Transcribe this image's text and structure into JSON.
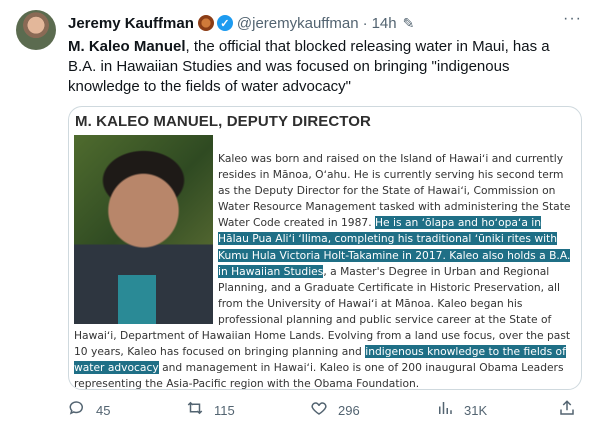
{
  "tweet": {
    "author_name": "Jeremy Kauffman",
    "handle": "@jeremykauffman",
    "separator": "·",
    "time": "14h",
    "text_bold": "M. Kaleo Manuel",
    "text_rest": ", the official that blocked releasing water in Maui, has a B.A. in Hawaiian Studies and was focused on bringing \"indigenous knowledge to the fields of water advocacy\""
  },
  "card": {
    "title": "M. KALEO MANUEL, DEPUTY DIRECTOR",
    "p1": "Kaleo was born and raised on the Island of Hawaiʻi and currently resides in Mānoa, Oʻahu. He is currently serving his second term as the Deputy Director for the State of Hawaiʻi, Commission on Water Resource Management tasked with administering the State Water Code created in 1987. ",
    "hl1": "He is an ʻōlapa and hoʻopaʻa in Hālau Pua Aliʻi ʻIlima, completing his traditional ʻūniki rites with Kumu Hula Victoria Holt-Takamine in 2017. Kaleo also holds a B.A. in Hawaiian Studies",
    "p2": ", a Master's Degree in Urban and Regional Planning, and a Graduate Certificate in Historic Preservation, all from the University of Hawaiʻi at Mānoa. Kaleo began his professional planning and public service career at the State of Hawaiʻi, Department of Hawaiian Home Lands. Evolving from a land use focus, over the past 10 years, Kaleo has focused on bringing planning and ",
    "hl2": "indigenous knowledge to the fields of water advocacy",
    "p3": " and management in Hawaiʻi. Kaleo is one of 200 inaugural Obama Leaders representing the Asia-Pacific region with the Obama Foundation."
  },
  "actions": {
    "replies": "45",
    "reposts": "115",
    "likes": "296",
    "views": "31K"
  },
  "icons": {
    "reply": "reply-icon",
    "repost": "repost-icon",
    "like": "heart-icon",
    "views": "views-icon",
    "share": "share-icon",
    "more": "more-icon",
    "edit": "edit-icon",
    "verified": "verified-icon"
  },
  "colors": {
    "highlight": "#1f6f86",
    "verified": "#1d9bf0",
    "muted": "#536471"
  }
}
